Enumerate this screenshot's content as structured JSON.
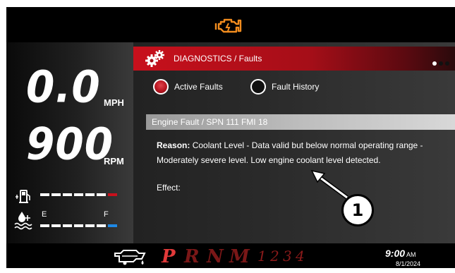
{
  "status": {
    "check_engine_icon": "check-engine-warning",
    "color": "#f28c1e"
  },
  "gauges": {
    "speed_value": "0.0",
    "speed_unit": "MPH",
    "rpm_value": "900",
    "rpm_unit": "RPM",
    "fuel_icon": "fuel-pump",
    "coolant_icon": "coolant-temperature",
    "empty_label": "E",
    "full_label": "F",
    "accent_red": "#c8101c",
    "accent_blue": "#1e88e5"
  },
  "header": {
    "icon": "gears",
    "title": "DIAGNOSTICS / Faults",
    "page_dots": 3,
    "active_dot": 0
  },
  "tabs": [
    {
      "label": "Active Faults",
      "selected": true
    },
    {
      "label": "Fault History",
      "selected": false
    }
  ],
  "fault": {
    "title": "Engine Fault / SPN 111 FMI 18",
    "reason_label": "Reason:",
    "reason_text": "Coolant Level - Data valid but below normal operating range - Moderately severe level.  Low engine coolant level detected.",
    "effect_label": "Effect:"
  },
  "transmission": {
    "gears": [
      "P",
      "R",
      "N",
      "M"
    ],
    "numbers": [
      "1",
      "2",
      "3",
      "4"
    ],
    "icon": "engine-oil"
  },
  "clock": {
    "time": "9:00",
    "ampm": "AM",
    "date": "8/1/2024"
  },
  "callout": {
    "number": "1"
  }
}
